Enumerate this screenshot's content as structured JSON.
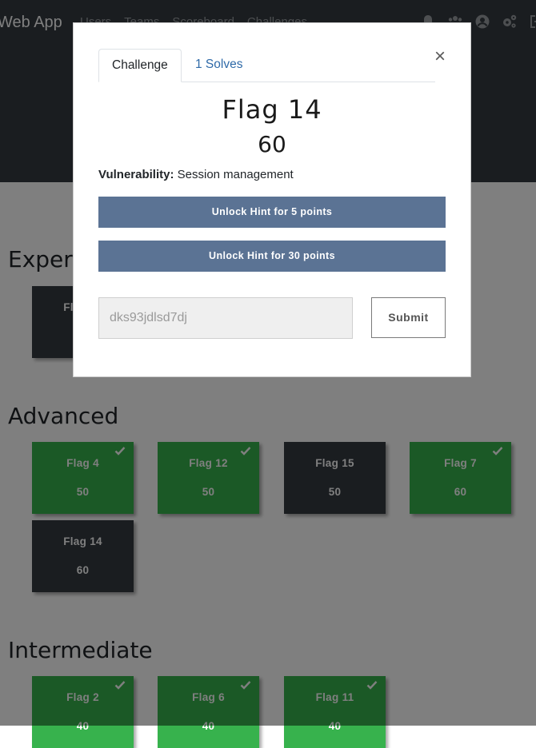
{
  "navbar": {
    "brand": "Web App",
    "links": [
      "Users",
      "Teams",
      "Scoreboard",
      "Challenges"
    ],
    "icons": [
      "bell-icon",
      "team-icon",
      "user-icon",
      "settings-icon",
      "logout-icon"
    ]
  },
  "categories": [
    {
      "title": "Expert",
      "challenges": [
        {
          "name": "Flag 13",
          "value": "",
          "solved": false
        }
      ]
    },
    {
      "title": "Advanced",
      "challenges": [
        {
          "name": "Flag 4",
          "value": "50",
          "solved": true
        },
        {
          "name": "Flag 12",
          "value": "50",
          "solved": true
        },
        {
          "name": "Flag 15",
          "value": "50",
          "solved": false
        },
        {
          "name": "Flag 7",
          "value": "60",
          "solved": true
        },
        {
          "name": "Flag 14",
          "value": "60",
          "solved": false
        }
      ]
    },
    {
      "title": "Intermediate",
      "challenges": [
        {
          "name": "Flag 2",
          "value": "40",
          "solved": true
        },
        {
          "name": "Flag 6",
          "value": "40",
          "solved": true
        },
        {
          "name": "Flag 11",
          "value": "40",
          "solved": true
        }
      ]
    }
  ],
  "modal": {
    "tab_challenge": "Challenge",
    "tab_solves": "1 Solves",
    "close": "×",
    "name": "Flag 14",
    "value": "60",
    "vuln_label": "Vulnerability:",
    "vuln_value": "Session management",
    "hint_buttons": [
      "Unlock Hint for 5 points",
      "Unlock Hint for 30 points"
    ],
    "input_value": "dks93jdlsd7dj",
    "submit_label": "Submit"
  },
  "colors": {
    "navbar": "#343a40",
    "solved": "#37b24d",
    "unsolved": "#343a40",
    "hint_button": "#5b7394",
    "link": "#2f6aa8"
  }
}
